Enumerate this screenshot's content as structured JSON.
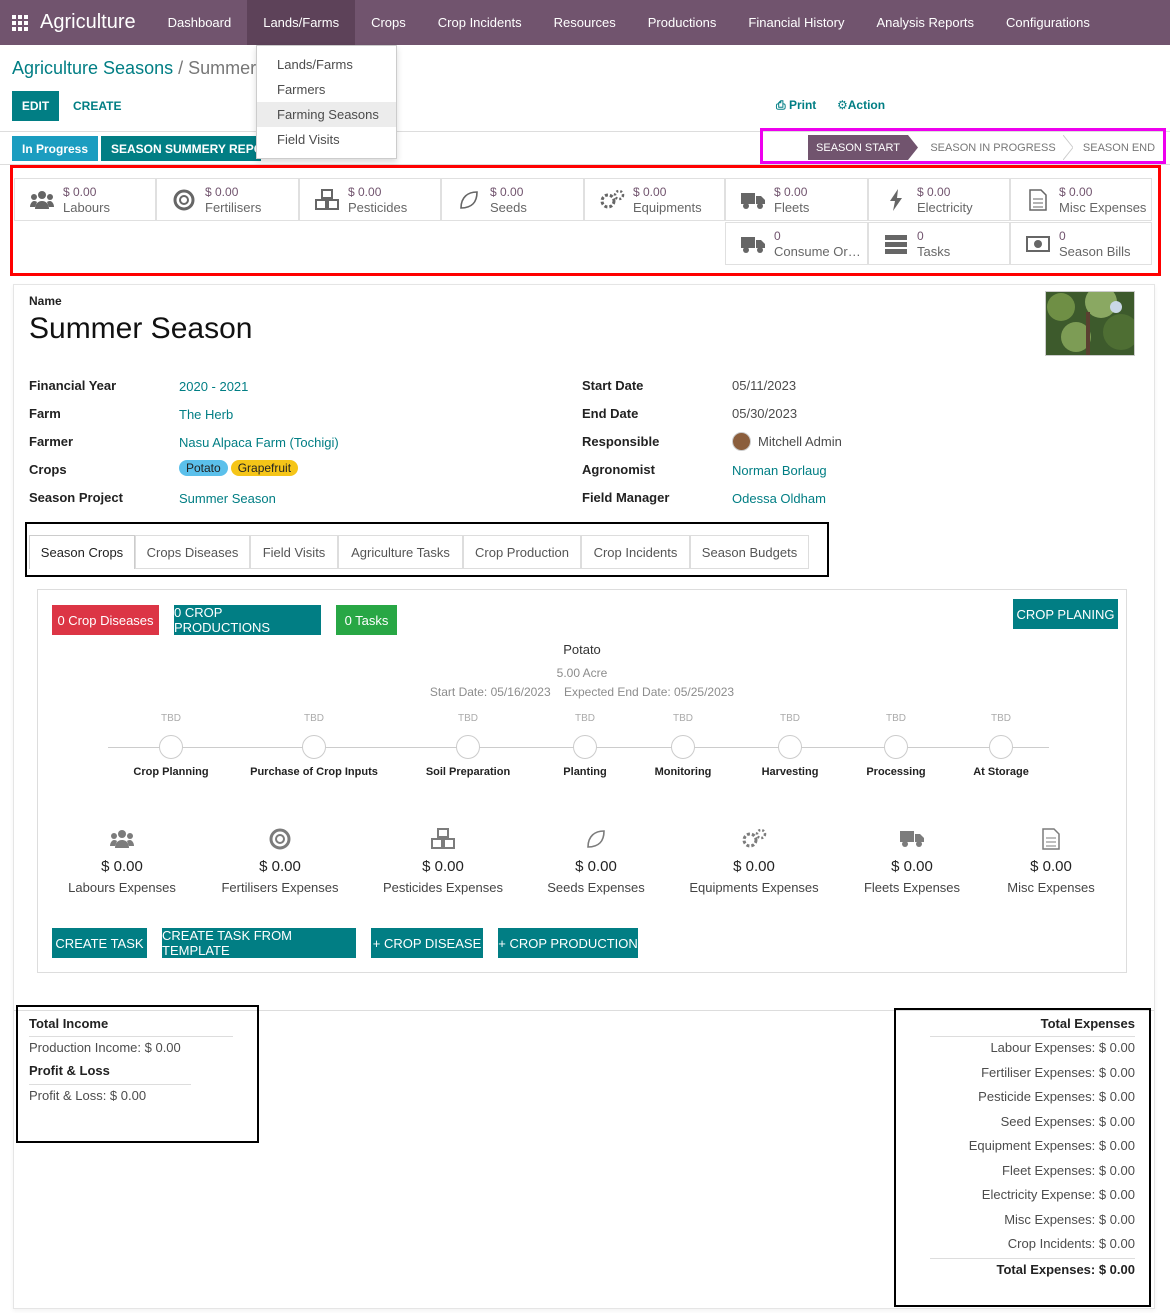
{
  "nav": {
    "brand": "Agriculture",
    "menus": [
      "Dashboard",
      "Lands/Farms",
      "Crops",
      "Crop Incidents",
      "Resources",
      "Productions",
      "Financial History",
      "Analysis Reports",
      "Configurations"
    ],
    "dropdown": [
      "Lands/Farms",
      "Farmers",
      "Farming Seasons",
      "Field Visits"
    ]
  },
  "breadcrumb": {
    "parent": "Agriculture Seasons",
    "sep": " / ",
    "current": "Summer"
  },
  "toolbar": {
    "edit": "EDIT",
    "create": "CREATE",
    "print": "Print",
    "action": "Action"
  },
  "header_buttons": {
    "in_progress": "In Progress",
    "summary": "SEASON SUMMERY REPORT"
  },
  "stages": [
    "SEASON START",
    "SEASON IN PROGRESS",
    "SEASON END"
  ],
  "stats": [
    {
      "value": "$ 0.00",
      "label": "Labours",
      "icon": "users-icon"
    },
    {
      "value": "$ 0.00",
      "label": "Fertilisers",
      "icon": "lifebuoy-icon"
    },
    {
      "value": "$ 0.00",
      "label": "Pesticides",
      "icon": "cubes-icon"
    },
    {
      "value": "$ 0.00",
      "label": "Seeds",
      "icon": "leaf-icon"
    },
    {
      "value": "$ 0.00",
      "label": "Equipments",
      "icon": "gears-icon"
    },
    {
      "value": "$ 0.00",
      "label": "Fleets",
      "icon": "truck-icon"
    },
    {
      "value": "$ 0.00",
      "label": "Electricity",
      "icon": "bolt-icon"
    },
    {
      "value": "$ 0.00",
      "label": "Misc Expenses",
      "icon": "file-icon"
    },
    {
      "value": "0",
      "label": "Consume Ord...",
      "icon": "truck-icon"
    },
    {
      "value": "0",
      "label": "Tasks",
      "icon": "server-icon"
    },
    {
      "value": "0",
      "label": "Season Bills",
      "icon": "money-icon"
    }
  ],
  "form": {
    "name_label": "Name",
    "name": "Summer Season",
    "left": [
      {
        "label": "Financial Year",
        "value": "2020 - 2021"
      },
      {
        "label": "Farm",
        "value": "The Herb"
      },
      {
        "label": "Farmer",
        "value": "Nasu Alpaca Farm (Tochigi)"
      },
      {
        "label": "Crops",
        "value": ""
      },
      {
        "label": "Season Project",
        "value": "Summer Season"
      }
    ],
    "crops_tags": [
      "Potato",
      "Grapefruit"
    ],
    "right": [
      {
        "label": "Start Date",
        "value": "05/11/2023"
      },
      {
        "label": "End Date",
        "value": "05/30/2023"
      },
      {
        "label": "Responsible",
        "value": "Mitchell Admin"
      },
      {
        "label": "Agronomist",
        "value": "Norman Borlaug"
      },
      {
        "label": "Field Manager",
        "value": "Odessa Oldham"
      }
    ]
  },
  "tabs": [
    "Season Crops",
    "Crops Diseases",
    "Field Visits",
    "Agriculture Tasks",
    "Crop Production",
    "Crop Incidents",
    "Season Budgets"
  ],
  "crop_card": {
    "btn_diseases": "0 Crop Diseases",
    "btn_productions": "0 CROP PRODUCTIONS",
    "btn_tasks": "0 Tasks",
    "btn_planing": "CROP PLANING",
    "crop": "Potato",
    "area": "5.00  Acre",
    "dates": "Start Date: 05/16/2023    Expected End Date: 05/25/2023",
    "steps": [
      "Crop Planning",
      "Purchase of Crop Inputs",
      "Soil Preparation",
      "Planting",
      "Monitoring",
      "Harvesting",
      "Processing",
      "At Storage"
    ],
    "tbd": "TBD",
    "expenses": [
      {
        "value": "$ 0.00",
        "label": "Labours Expenses"
      },
      {
        "value": "$ 0.00",
        "label": "Fertilisers Expenses"
      },
      {
        "value": "$ 0.00",
        "label": "Pesticides Expenses"
      },
      {
        "value": "$ 0.00",
        "label": "Seeds Expenses"
      },
      {
        "value": "$ 0.00",
        "label": "Equipments Expenses"
      },
      {
        "value": "$ 0.00",
        "label": "Fleets Expenses"
      },
      {
        "value": "$ 0.00",
        "label": "Misc Expenses"
      }
    ],
    "actions": [
      "CREATE TASK",
      "CREATE TASK FROM TEMPLATE",
      "+ CROP DISEASE",
      "+ CROP PRODUCTION"
    ]
  },
  "income": {
    "title": "Total Income",
    "production": "Production Income: $ 0.00",
    "pl_title": "Profit & Loss",
    "pl": "Profit & Loss: $ 0.00"
  },
  "expenses": {
    "title": "Total Expenses",
    "lines": [
      "Labour Expenses: $ 0.00",
      "Fertiliser Expenses: $ 0.00",
      "Pesticide Expenses: $ 0.00",
      "Seed Expenses: $ 0.00",
      "Equipment Expenses: $ 0.00",
      "Fleet Expenses: $ 0.00",
      "Electricity Expense: $ 0.00",
      "Misc Expenses: $ 0.00",
      "Crop Incidents: $ 0.00"
    ],
    "total": "Total Expenses: $ 0.00"
  }
}
